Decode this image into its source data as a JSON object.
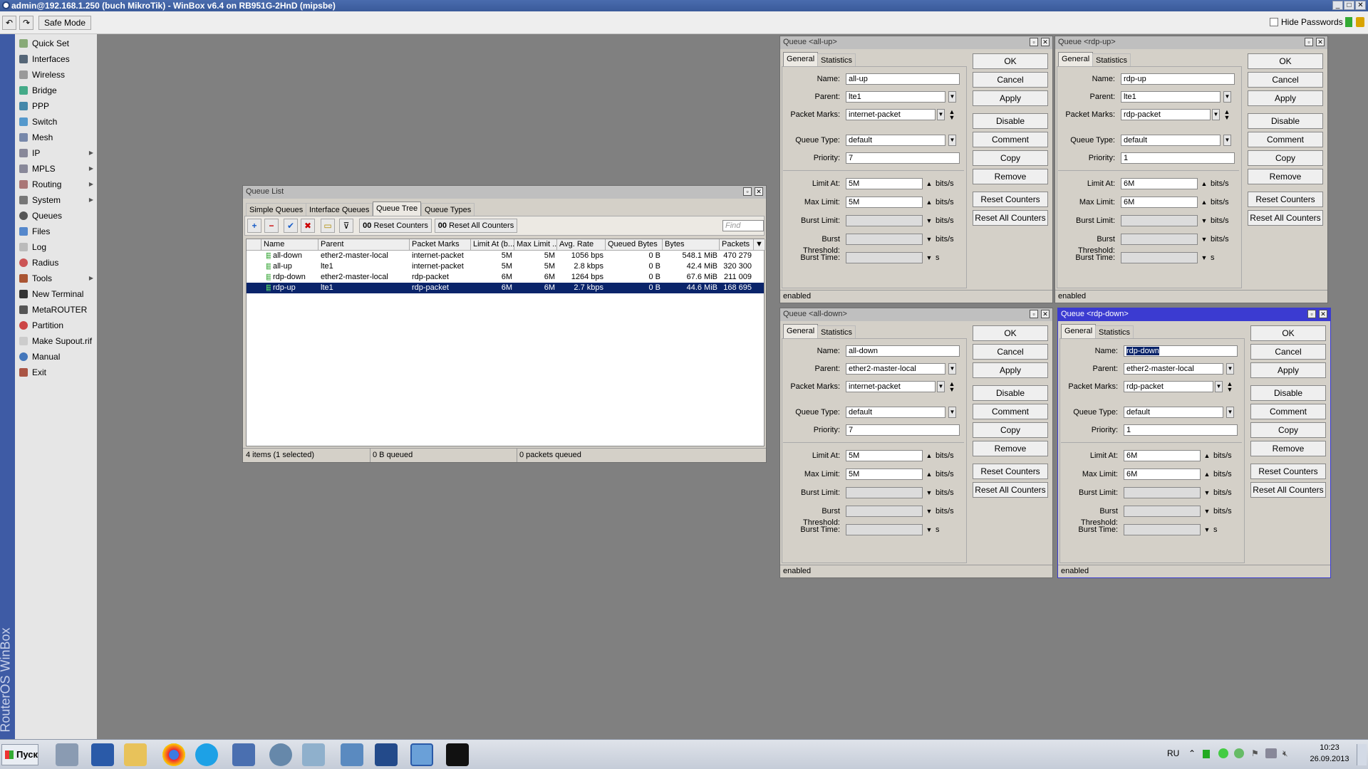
{
  "window": {
    "title": "admin@192.168.1.250 (buch MikroTik) - WinBox v6.4 on RB951G-2HnD (mipsbe)"
  },
  "toolbar": {
    "safe_mode": "Safe Mode",
    "hide_passwords": "Hide Passwords"
  },
  "sidebar": {
    "brand": "RouterOS WinBox",
    "items": [
      {
        "label": "Quick Set"
      },
      {
        "label": "Interfaces"
      },
      {
        "label": "Wireless"
      },
      {
        "label": "Bridge"
      },
      {
        "label": "PPP"
      },
      {
        "label": "Switch"
      },
      {
        "label": "Mesh"
      },
      {
        "label": "IP"
      },
      {
        "label": "MPLS"
      },
      {
        "label": "Routing"
      },
      {
        "label": "System"
      },
      {
        "label": "Queues"
      },
      {
        "label": "Files"
      },
      {
        "label": "Log"
      },
      {
        "label": "Radius"
      },
      {
        "label": "Tools"
      },
      {
        "label": "New Terminal"
      },
      {
        "label": "MetaROUTER"
      },
      {
        "label": "Partition"
      },
      {
        "label": "Make Supout.rif"
      },
      {
        "label": "Manual"
      },
      {
        "label": "Exit"
      }
    ]
  },
  "queue_list": {
    "title": "Queue List",
    "tabs": [
      "Simple Queues",
      "Interface Queues",
      "Queue Tree",
      "Queue Types"
    ],
    "reset_counters": "Reset Counters",
    "reset_all_counters": "Reset All Counters",
    "counter_prefix": "00",
    "find_placeholder": "Find",
    "columns": [
      "Name",
      "Parent",
      "Packet Marks",
      "Limit At (b...",
      "Max Limit ...",
      "Avg. Rate",
      "Queued Bytes",
      "Bytes",
      "Packets"
    ],
    "rows": [
      {
        "name": "all-down",
        "parent": "ether2-master-local",
        "marks": "internet-packet",
        "limit_at": "5M",
        "max_limit": "5M",
        "avg_rate": "1056 bps",
        "queued": "0 B",
        "bytes": "548.1 MiB",
        "packets": "470 279"
      },
      {
        "name": "all-up",
        "parent": "lte1",
        "marks": "internet-packet",
        "limit_at": "5M",
        "max_limit": "5M",
        "avg_rate": "2.8 kbps",
        "queued": "0 B",
        "bytes": "42.4 MiB",
        "packets": "320 300"
      },
      {
        "name": "rdp-down",
        "parent": "ether2-master-local",
        "marks": "rdp-packet",
        "limit_at": "6M",
        "max_limit": "6M",
        "avg_rate": "1264 bps",
        "queued": "0 B",
        "bytes": "67.6 MiB",
        "packets": "211 009"
      },
      {
        "name": "rdp-up",
        "parent": "lte1",
        "marks": "rdp-packet",
        "limit_at": "6M",
        "max_limit": "6M",
        "avg_rate": "2.7 kbps",
        "queued": "0 B",
        "bytes": "44.6 MiB",
        "packets": "168 695"
      }
    ],
    "status": {
      "items": "4 items (1 selected)",
      "queued": "0 B queued",
      "packets": "0 packets queued"
    }
  },
  "labels": {
    "general": "General",
    "statistics": "Statistics",
    "name": "Name:",
    "parent": "Parent:",
    "packet_marks": "Packet Marks:",
    "queue_type": "Queue Type:",
    "priority": "Priority:",
    "limit_at": "Limit At:",
    "max_limit": "Max Limit:",
    "burst_limit": "Burst Limit:",
    "burst_threshold": "Burst Threshold:",
    "burst_time": "Burst Time:",
    "bits": "bits/s",
    "s": "s",
    "ok": "OK",
    "cancel": "Cancel",
    "apply": "Apply",
    "disable": "Disable",
    "comment": "Comment",
    "copy": "Copy",
    "remove": "Remove",
    "reset_counters": "Reset Counters",
    "reset_all_counters": "Reset All Counters"
  },
  "dialogs": {
    "all_up": {
      "title": "Queue <all-up>",
      "name": "all-up",
      "parent": "lte1",
      "marks": "internet-packet",
      "queue_type": "default",
      "priority": "7",
      "limit_at": "5M",
      "max_limit": "5M",
      "status": "enabled"
    },
    "rdp_up": {
      "title": "Queue <rdp-up>",
      "name": "rdp-up",
      "parent": "lte1",
      "marks": "rdp-packet",
      "queue_type": "default",
      "priority": "1",
      "limit_at": "6M",
      "max_limit": "6M",
      "status": "enabled"
    },
    "all_down": {
      "title": "Queue <all-down>",
      "name": "all-down",
      "parent": "ether2-master-local",
      "marks": "internet-packet",
      "queue_type": "default",
      "priority": "7",
      "limit_at": "5M",
      "max_limit": "5M",
      "status": "enabled"
    },
    "rdp_down": {
      "title": "Queue <rdp-down>",
      "name": "rdp-down",
      "parent": "ether2-master-local",
      "marks": "rdp-packet",
      "queue_type": "default",
      "priority": "1",
      "limit_at": "6M",
      "max_limit": "6M",
      "status": "enabled"
    }
  },
  "taskbar": {
    "start": "Пуск",
    "lang": "RU",
    "time": "10:23",
    "date": "26.09.2013"
  }
}
